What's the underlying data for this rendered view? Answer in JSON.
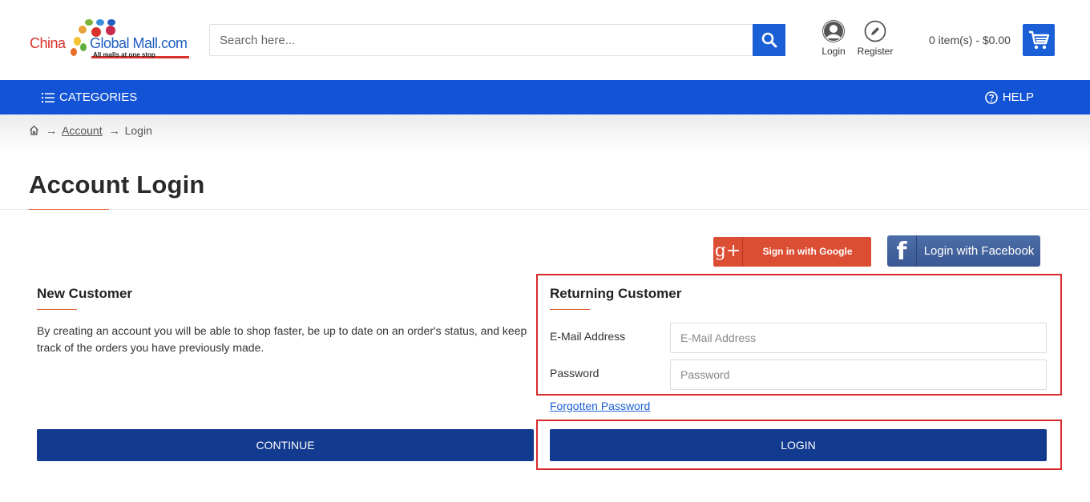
{
  "header": {
    "logo": {
      "word1": "China",
      "word2": "Global Mall.com",
      "tagline": "All malls at one stop"
    },
    "search": {
      "placeholder": "Search here...",
      "value": ""
    },
    "login_label": "Login",
    "register_label": "Register",
    "cart_text": "0 item(s) - $0.00"
  },
  "navbar": {
    "categories_label": "CATEGORIES",
    "help_label": "HELP"
  },
  "breadcrumb": {
    "items": [
      "Account",
      "Login"
    ]
  },
  "page": {
    "title": "Account Login"
  },
  "social": {
    "google_icon_text": "g+",
    "google_label": "Sign in with Google",
    "facebook_icon_text": "f",
    "facebook_label": "Login with Facebook"
  },
  "new_customer": {
    "title": "New Customer",
    "description": "By creating an account you will be able to shop faster, be up to date on an order's status, and keep track of the orders you have previously made.",
    "continue_label": "CONTINUE"
  },
  "returning_customer": {
    "title": "Returning Customer",
    "email_label": "E-Mail Address",
    "email_placeholder": "E-Mail Address",
    "email_value": "",
    "password_label": "Password",
    "password_placeholder": "Password",
    "password_value": "",
    "forgot_label": "Forgotten Password",
    "login_label": "LOGIN"
  },
  "colors": {
    "primary": "#1354d6",
    "button_dark": "#123a8f",
    "accent": "#e05a2b",
    "highlight": "#d52b2b",
    "google": "#dc4e33",
    "facebook": "#3b5998"
  }
}
